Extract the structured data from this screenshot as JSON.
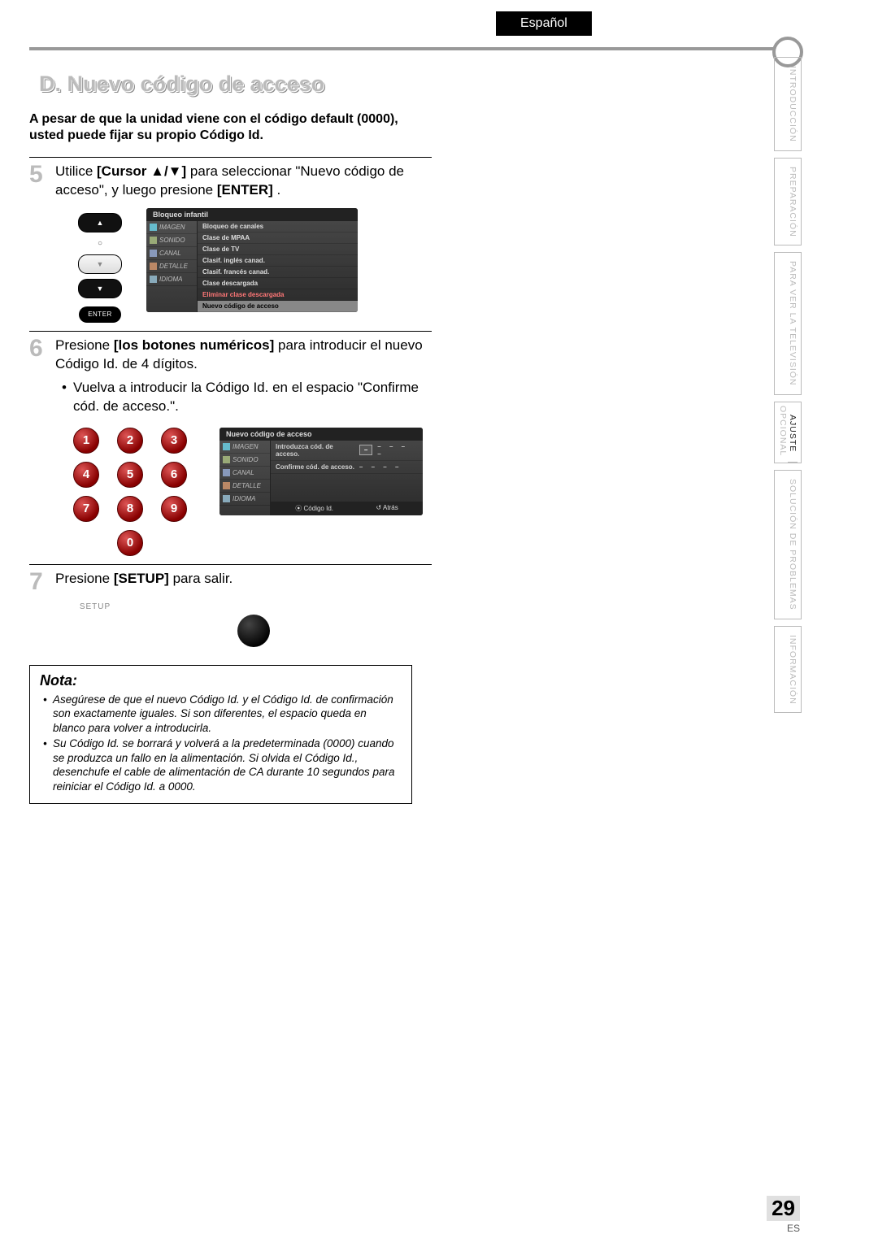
{
  "language_tab": "Español",
  "section_heading": "D. Nuevo código de acceso",
  "intro": "A pesar de que la unidad viene con el código default (0000), usted puede fijar su propio Código Id.",
  "step5": {
    "num": "5",
    "pre": "Utilice ",
    "bold1": "[Cursor ▲/▼]",
    "mid": " para seleccionar \"Nuevo código de acceso\", y luego presione ",
    "bold2": "[ENTER]",
    "post": "."
  },
  "remote": {
    "circle": "○",
    "enter": "ENTER"
  },
  "osd1": {
    "title": "Bloqueo infantil",
    "cats": [
      "IMAGEN",
      "SONIDO",
      "CANAL",
      "DETALLE",
      "IDIOMA"
    ],
    "items": [
      {
        "t": "Bloqueo de canales",
        "cls": ""
      },
      {
        "t": "Clase de MPAA",
        "cls": ""
      },
      {
        "t": "Clase de TV",
        "cls": ""
      },
      {
        "t": "Clasif. inglés canad.",
        "cls": ""
      },
      {
        "t": "Clasif. francés canad.",
        "cls": ""
      },
      {
        "t": "Clase descargada",
        "cls": ""
      },
      {
        "t": "Eliminar clase descargada",
        "cls": "red"
      },
      {
        "t": "Nuevo código de acceso",
        "cls": "sel"
      }
    ]
  },
  "step6": {
    "num": "6",
    "pre": "Presione ",
    "bold1": "[los botones numéricos]",
    "mid": " para introducir el nuevo Código Id. de 4 dígitos.",
    "bullet": "Vuelva a introducir la Código Id. en el espacio \"Confirme cód. de acceso.\"."
  },
  "numpad": [
    "1",
    "2",
    "3",
    "4",
    "5",
    "6",
    "7",
    "8",
    "9",
    "0"
  ],
  "osd2": {
    "title": "Nuevo código de acceso",
    "cats": [
      "IMAGEN",
      "SONIDO",
      "CANAL",
      "DETALLE",
      "IDIOMA"
    ],
    "row1_label": "Introduzca cód. de acceso.",
    "row1_box": "–",
    "row2_label": "Confirme cód. de acceso.",
    "dash": "–   –   –   –",
    "foot_left": "Código Id.",
    "foot_right": "Atrás"
  },
  "step7": {
    "num": "7",
    "pre": "Presione ",
    "bold1": "[SETUP]",
    "post": " para salir."
  },
  "setup_label": "SETUP",
  "note": {
    "title": "Nota:",
    "items": [
      "Asegúrese de que el nuevo Código Id. y el Código Id. de confirmación son exactamente iguales. Si son diferentes, el espacio queda en blanco para volver a introducirla.",
      "Su Código Id. se borrará y volverá a la predeterminada (0000) cuando se produzca un fallo en la alimentación. Si olvida el Código Id., desenchufe el cable de alimentación de CA durante 10 segundos para reiniciar el Código Id. a 0000."
    ]
  },
  "side_tabs": [
    "INTRODUCCIÓN",
    "PREPARACIÓN",
    "PARA VER LA TELEVISIÓN",
    {
      "a": "AJUSTE",
      "b": "OPCIONAL"
    },
    "SOLUCIÓN DE PROBLEMAS",
    "INFORMACIÓN"
  ],
  "page_number": "29",
  "page_lang": "ES"
}
